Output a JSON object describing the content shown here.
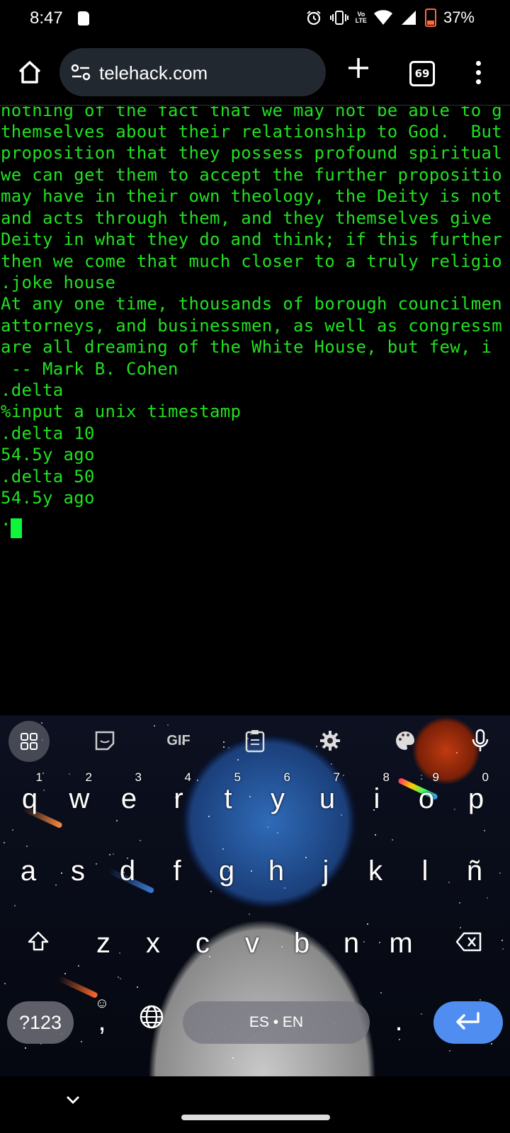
{
  "status_bar": {
    "time": "8:47",
    "volte": "Vo LTE",
    "battery": "37%"
  },
  "browser": {
    "url": "telehack.com",
    "tab_count": "69"
  },
  "terminal": {
    "lines": [
      "nothing of the fact that we may not be able to g",
      "themselves about their relationship to God.  But",
      "proposition that they possess profound spiritual",
      "we can get them to accept the further propositio",
      "may have in their own theology, the Deity is not",
      "and acts through them, and they themselves give",
      "Deity in what they do and think; if this further",
      "then we come that much closer to a truly religio",
      ".joke house",
      "At any one time, thousands of borough councilmen",
      "attorneys, and businessmen, as well as congressm",
      "are all dreaming of the White House, but few, i",
      " -- Mark B. Cohen",
      ".delta",
      "%input a unix timestamp",
      ".delta 10",
      "54.5y ago",
      ".delta 50",
      "54.5y ago",
      "."
    ],
    "text_color": "#21e021"
  },
  "keyboard": {
    "toolbar_gif": "GIF",
    "row1": [
      {
        "key": "q",
        "hint": "1"
      },
      {
        "key": "w",
        "hint": "2"
      },
      {
        "key": "e",
        "hint": "3"
      },
      {
        "key": "r",
        "hint": "4"
      },
      {
        "key": "t",
        "hint": "5"
      },
      {
        "key": "y",
        "hint": "6"
      },
      {
        "key": "u",
        "hint": "7"
      },
      {
        "key": "i",
        "hint": "8"
      },
      {
        "key": "o",
        "hint": "9"
      },
      {
        "key": "p",
        "hint": "0"
      }
    ],
    "row2": [
      "a",
      "s",
      "d",
      "f",
      "g",
      "h",
      "j",
      "k",
      "l",
      "ñ"
    ],
    "row3": [
      "z",
      "x",
      "c",
      "v",
      "b",
      "n",
      "m"
    ],
    "symbols_label": "?123",
    "emoji_comma": ",",
    "space_label": "ES • EN",
    "period": ".",
    "accent_color": "#4f8ef0"
  }
}
